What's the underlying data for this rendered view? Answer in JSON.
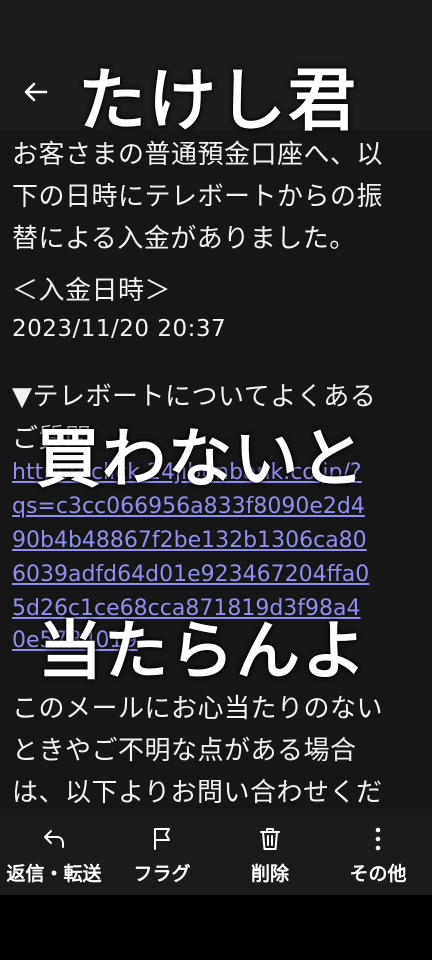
{
  "header": {
    "back_icon": "arrow-left-icon",
    "title": "たけし君"
  },
  "message": {
    "lines": [
      "お客さまの普通預金口座へ、以",
      "下の日時にテレボートからの振",
      "替による入金がありました。",
      "＜入金日時＞"
    ],
    "datetime": "2023/11/20 20:37",
    "faq_line1": "▼テレボートについてよくある",
    "faq_line2": "ご質問",
    "link_lines": [
      "https://click.24jibunbank.co.jp/?",
      "qs=c3cc066956a833f8090e2d4",
      "90b4b48867f2be132b1306ca80",
      "6039adfd64d01e923467204ffa0",
      "5d26c1ce68cca871819d3f98a4",
      "0e5784019"
    ],
    "tail_lines": [
      "このメールにお心当たりのない",
      "ときやご不明な点がある場合",
      "は、以下よりお問い合わせくだ"
    ]
  },
  "overlays": {
    "middle": "買わないと",
    "lower": "当たらんよ"
  },
  "toolbar": {
    "items": [
      {
        "label": "返信・転送",
        "icon": "reply-icon"
      },
      {
        "label": "フラグ",
        "icon": "flag-icon"
      },
      {
        "label": "削除",
        "icon": "trash-icon"
      },
      {
        "label": "その他",
        "icon": "more-vertical-icon"
      }
    ]
  },
  "colors": {
    "link": "#8f8ff0",
    "header_bg": "#1c1c1c",
    "body_bg": "#161616",
    "toolbar_bg": "#1b1b1b"
  }
}
